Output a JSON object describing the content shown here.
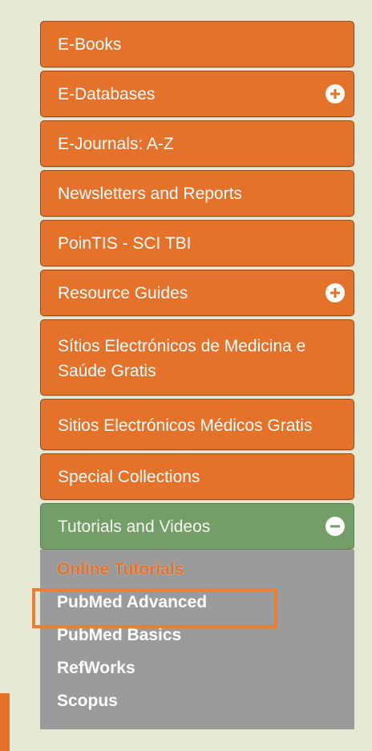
{
  "colors": {
    "page_background": "#e5e8d3",
    "menu_item": "#e4722b",
    "active_item": "#749e67",
    "submenu_background": "#9b9b9b",
    "highlight": "#ed7d31"
  },
  "menu": {
    "items": [
      {
        "label": "E-Books",
        "icon": null
      },
      {
        "label": "E-Databases",
        "icon": "plus-circle-icon"
      },
      {
        "label": "E-Journals: A-Z",
        "icon": null
      },
      {
        "label": "Newsletters and Reports",
        "icon": null
      },
      {
        "label": "PoinTIS - SCI TBI",
        "icon": null
      },
      {
        "label": "Resource Guides",
        "icon": "plus-circle-icon"
      },
      {
        "label": "Sítios Electrónicos de Medicina e Saúde Gratis",
        "icon": null
      },
      {
        "label": "Sitios Electrónicos Médicos Gratis",
        "icon": null
      },
      {
        "label": "Special Collections",
        "icon": null
      },
      {
        "label": "Tutorials and Videos",
        "icon": "minus-circle-icon",
        "expanded": true
      }
    ]
  },
  "submenu": {
    "items": [
      {
        "label": "Online Tutorials",
        "current": true
      },
      {
        "label": "PubMed Advanced"
      },
      {
        "label": "PubMed Basics"
      },
      {
        "label": "RefWorks"
      },
      {
        "label": "Scopus"
      }
    ]
  }
}
